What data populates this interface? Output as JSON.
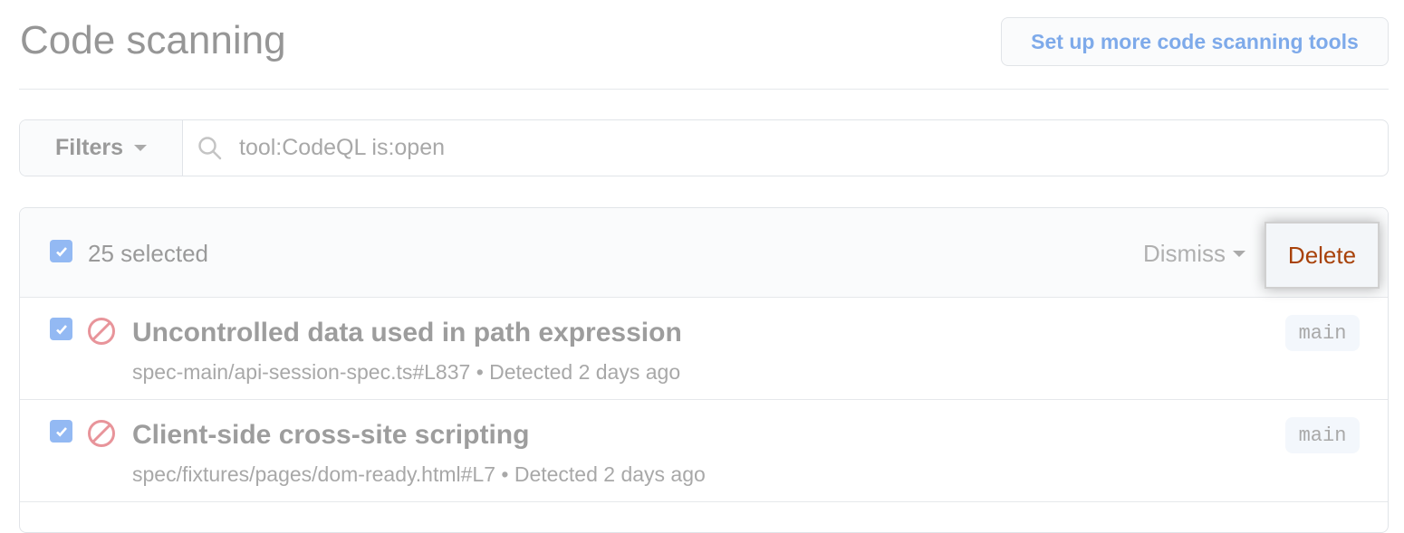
{
  "header": {
    "title": "Code scanning",
    "setup_button": "Set up more code scanning tools"
  },
  "filter": {
    "filters_label": "Filters",
    "query": "tool:CodeQL is:open"
  },
  "bulk": {
    "selected": "25 selected",
    "dismiss": "Dismiss",
    "delete": "Delete"
  },
  "alerts": [
    {
      "title": "Uncontrolled data used in path expression",
      "meta": "spec-main/api-session-spec.ts#L837 • Detected 2  days ago",
      "branch": "main"
    },
    {
      "title": "Client-side cross-site scripting",
      "meta": "spec/fixtures/pages/dom-ready.html#L7 • Detected 2  days ago",
      "branch": "main"
    }
  ],
  "colors": {
    "accent": "#7eaaea",
    "delete": "#a8420a",
    "alert_icon": "#e8949a",
    "checkbox": "#93b9f3"
  }
}
